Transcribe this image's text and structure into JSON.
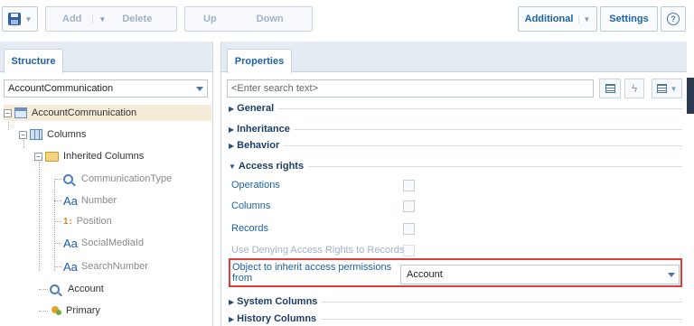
{
  "toolbar": {
    "add_label": "Add",
    "delete_label": "Delete",
    "up_label": "Up",
    "down_label": "Down",
    "additional_label": "Additional",
    "settings_label": "Settings",
    "help_glyph": "?"
  },
  "structure": {
    "tab_label": "Structure",
    "object_select_value": "AccountCommunication",
    "tree": {
      "root": "AccountCommunication",
      "columns": "Columns",
      "inherited_columns": "Inherited Columns",
      "inherited_items": [
        {
          "label": "CommunicationType",
          "icon": "lookup-icon"
        },
        {
          "label": "Number",
          "icon": "text-icon",
          "glyph": "Aa"
        },
        {
          "label": "Position",
          "icon": "integer-icon",
          "glyph": "1↕"
        },
        {
          "label": "SocialMediaId",
          "icon": "text-icon",
          "glyph": "Aa"
        },
        {
          "label": "SearchNumber",
          "icon": "text-icon",
          "glyph": "Aa"
        }
      ],
      "account": "Account",
      "primary": "Primary"
    }
  },
  "properties": {
    "tab_label": "Properties",
    "search_placeholder": "<Enter search text>",
    "groups": {
      "general": "General",
      "inheritance": "Inheritance",
      "behavior": "Behavior",
      "access_rights": "Access rights",
      "system_columns": "System Columns",
      "history_columns": "History Columns"
    },
    "access_rights_items": [
      {
        "label": "Operations",
        "checked": false,
        "enabled": true
      },
      {
        "label": "Columns",
        "checked": false,
        "enabled": true
      },
      {
        "label": "Records",
        "checked": false,
        "enabled": true
      },
      {
        "label": "Use Denying Access Rights to Records",
        "checked": false,
        "enabled": false
      }
    ],
    "inherit_label_line1": "Object to inherit access permissions",
    "inherit_label_line2": "from",
    "inherit_value": "Account"
  },
  "colors": {
    "accent": "#1c62a8",
    "highlight_border": "#e23b3b",
    "panel_header": "#e5ebf2"
  }
}
